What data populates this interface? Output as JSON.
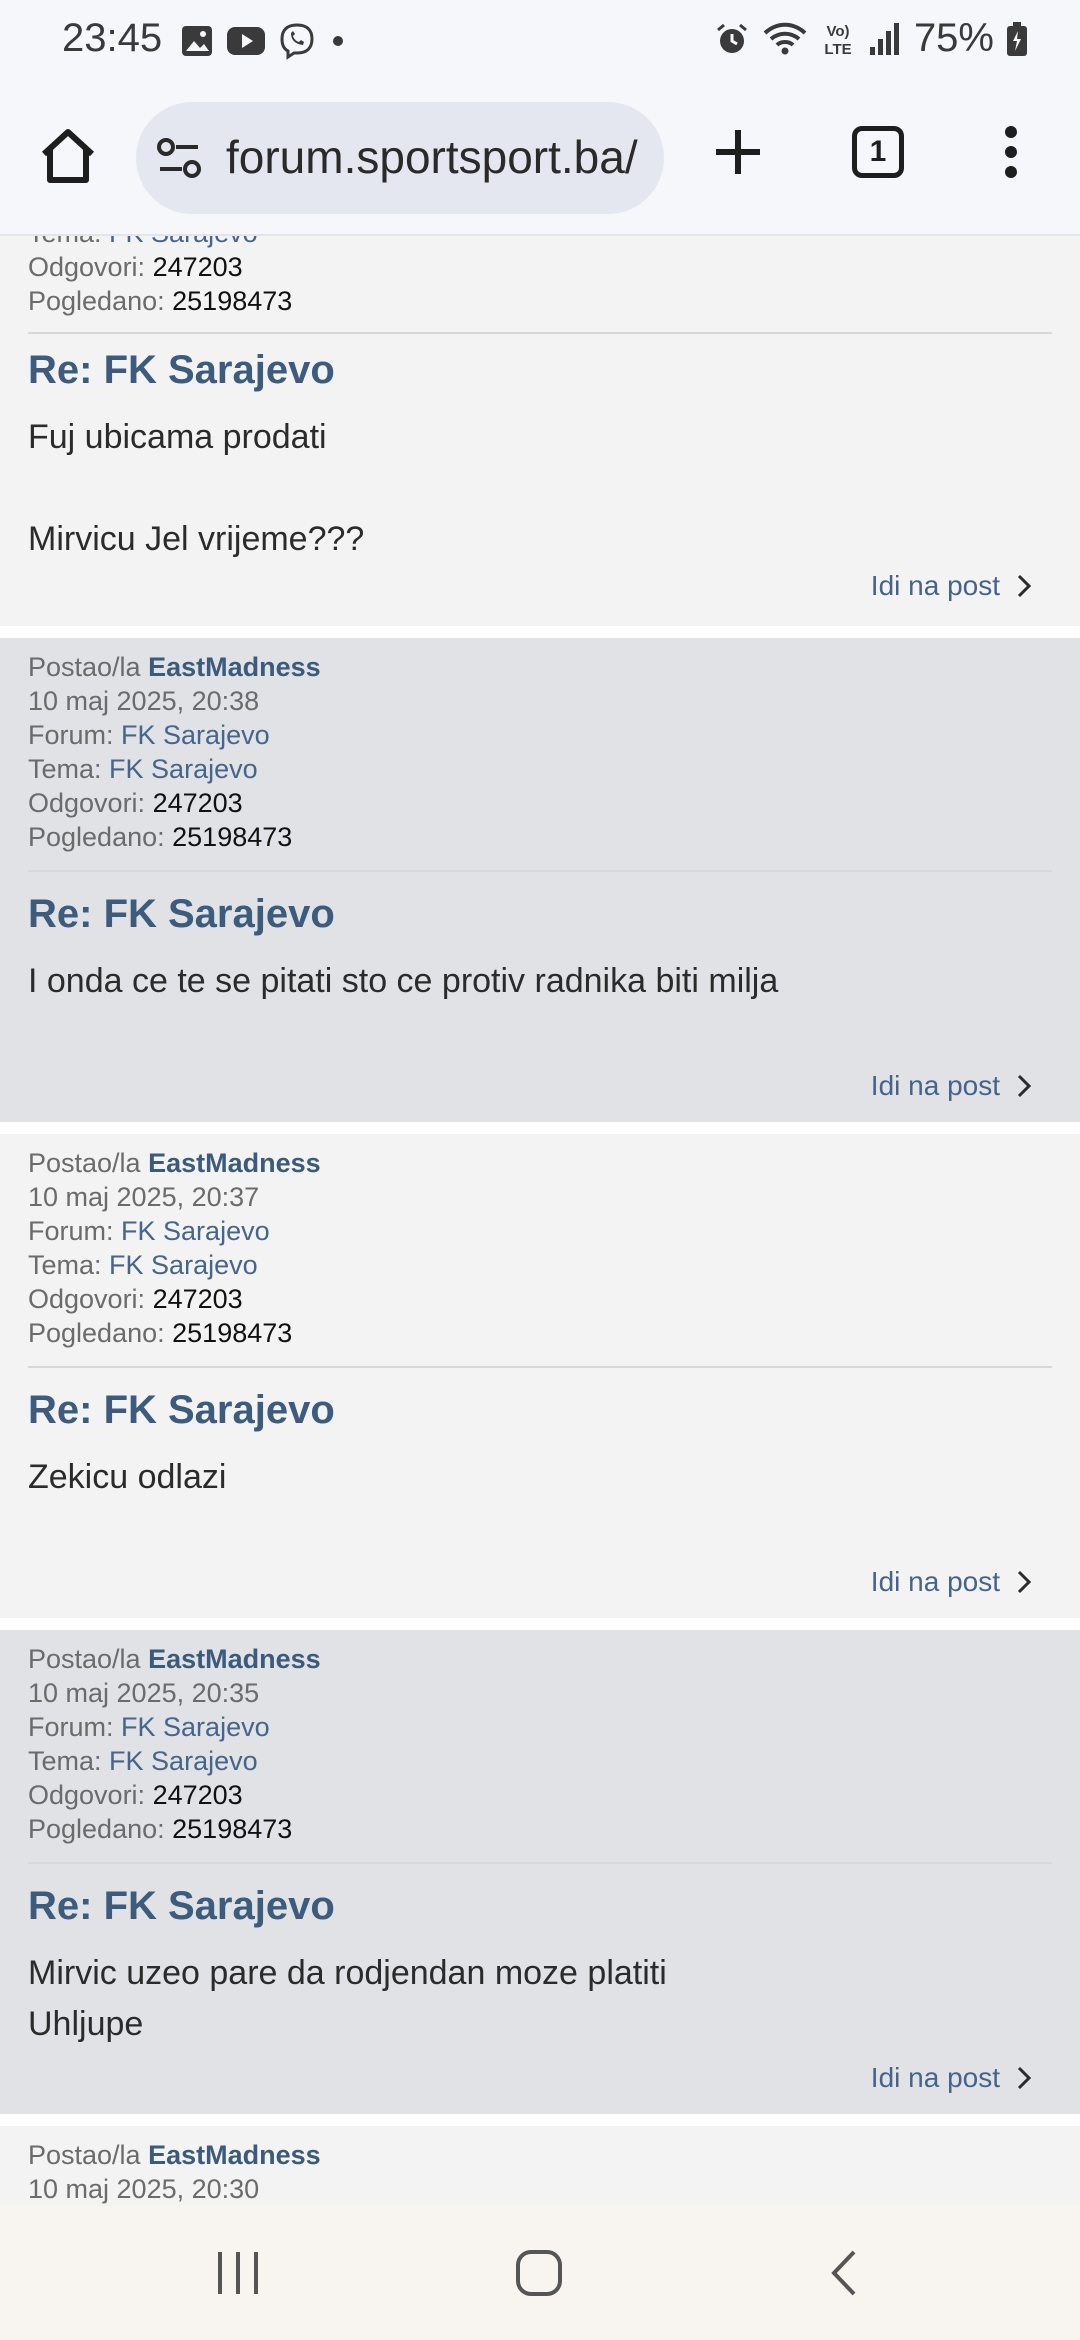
{
  "status_bar": {
    "time": "23:45",
    "battery": "75%",
    "left_icons": [
      "gallery-icon",
      "youtube-icon",
      "viber-icon",
      "dot-icon"
    ],
    "right_icons": [
      "alarm-icon",
      "wifi-icon",
      "volte-icon",
      "signal-icon",
      "battery-icon"
    ]
  },
  "browser": {
    "url": "forum.sportsport.ba/",
    "tab_count": "1"
  },
  "posts": [
    {
      "partial": true,
      "tema_label": "Tema:",
      "tema": "FK Sarajevo",
      "odgovori_label": "Odgovori:",
      "odgovori": "247203",
      "pogledano_label": "Pogledano:",
      "pogledano": "25198473",
      "title": "Re: FK Sarajevo",
      "body": "Fuj ubicama prodati\n\nMirvicu Jel vrijeme???",
      "go_label": "Idi na post"
    },
    {
      "author_label": "Postao/la",
      "author": "EastMadness",
      "date": "10 maj 2025, 20:38",
      "forum_label": "Forum:",
      "forum": "FK Sarajevo",
      "tema_label": "Tema:",
      "tema": "FK Sarajevo",
      "odgovori_label": "Odgovori:",
      "odgovori": "247203",
      "pogledano_label": "Pogledano:",
      "pogledano": "25198473",
      "title": "Re: FK Sarajevo",
      "body": "I onda ce te se pitati sto ce protiv radnika biti milja",
      "go_label": "Idi na post"
    },
    {
      "author_label": "Postao/la",
      "author": "EastMadness",
      "date": "10 maj 2025, 20:37",
      "forum_label": "Forum:",
      "forum": "FK Sarajevo",
      "tema_label": "Tema:",
      "tema": "FK Sarajevo",
      "odgovori_label": "Odgovori:",
      "odgovori": "247203",
      "pogledano_label": "Pogledano:",
      "pogledano": "25198473",
      "title": "Re: FK Sarajevo",
      "body": "Zekicu odlazi",
      "go_label": "Idi na post"
    },
    {
      "author_label": "Postao/la",
      "author": "EastMadness",
      "date": "10 maj 2025, 20:35",
      "forum_label": "Forum:",
      "forum": "FK Sarajevo",
      "tema_label": "Tema:",
      "tema": "FK Sarajevo",
      "odgovori_label": "Odgovori:",
      "odgovori": "247203",
      "pogledano_label": "Pogledano:",
      "pogledano": "25198473",
      "title": "Re: FK Sarajevo",
      "body": "Mirvic uzeo pare da rodjendan moze platiti\nUhljupe",
      "go_label": "Idi na post"
    },
    {
      "partial": true,
      "author_label": "Postao/la",
      "author": "EastMadness",
      "date": "10 maj 2025, 20:30"
    }
  ],
  "colors": {
    "accent": "#3d5c7d",
    "post_light": "#f3f3f3",
    "post_dark": "#e0e2e5"
  }
}
